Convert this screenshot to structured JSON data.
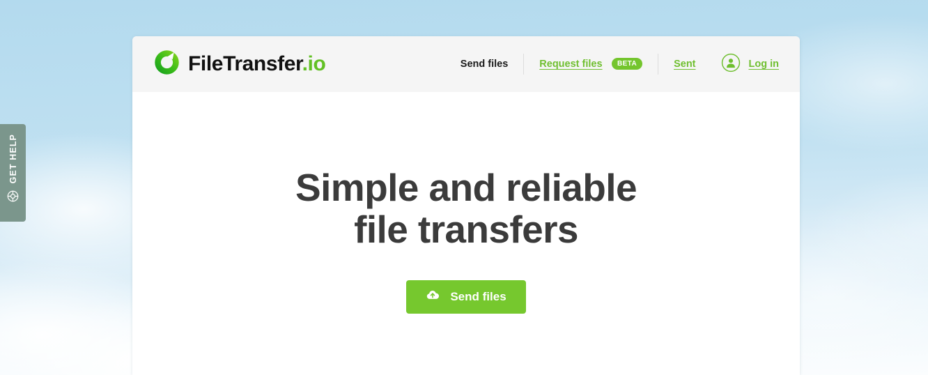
{
  "help_tab": {
    "label": "GET HELP",
    "icon": "lifebuoy-icon"
  },
  "header": {
    "brand": {
      "icon": "filetransfer-logo-icon",
      "name": "FileTransfer",
      "tld": ".io"
    },
    "nav": [
      {
        "label": "Send files",
        "state": "active"
      },
      {
        "label": "Request files",
        "badge": "BETA",
        "state": "link"
      },
      {
        "label": "Sent",
        "state": "link"
      }
    ],
    "login": {
      "icon": "user-circle-icon",
      "label": "Log in"
    }
  },
  "hero": {
    "headline_line1": "Simple and reliable",
    "headline_line2": "file transfers",
    "cta": {
      "icon": "cloud-upload-icon",
      "label": "Send files"
    }
  },
  "colors": {
    "brand_green": "#6fbf2f",
    "button_green": "#76c82e",
    "badge_green": "#74c52d",
    "headline_gray": "#3b3b3b",
    "header_bg": "#f5f5f5",
    "help_tab_bg": "#7b968c",
    "sky_blue": "#b3daee"
  }
}
